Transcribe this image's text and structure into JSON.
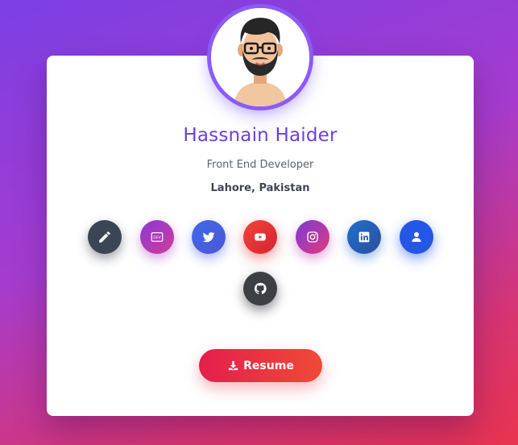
{
  "profile": {
    "name": "Hassnain Haider",
    "title": "Front End Developer",
    "location": "Lahore, Pakistan"
  },
  "social": {
    "items": [
      {
        "id": "blog",
        "icon": "pencil-icon"
      },
      {
        "id": "dev",
        "icon": "dev-icon",
        "label": "DEV"
      },
      {
        "id": "twitter",
        "icon": "twitter-icon"
      },
      {
        "id": "youtube",
        "icon": "youtube-icon"
      },
      {
        "id": "instagram",
        "icon": "instagram-icon"
      },
      {
        "id": "linkedin",
        "icon": "linkedin-icon"
      },
      {
        "id": "about",
        "icon": "user-icon"
      },
      {
        "id": "github",
        "icon": "github-icon"
      }
    ]
  },
  "resume": {
    "label": "Resume",
    "icon": "download-icon"
  },
  "colors": {
    "accent": "#6a3fe0",
    "button_gradient_start": "#e41e4c",
    "button_gradient_end": "#ef4a36"
  }
}
